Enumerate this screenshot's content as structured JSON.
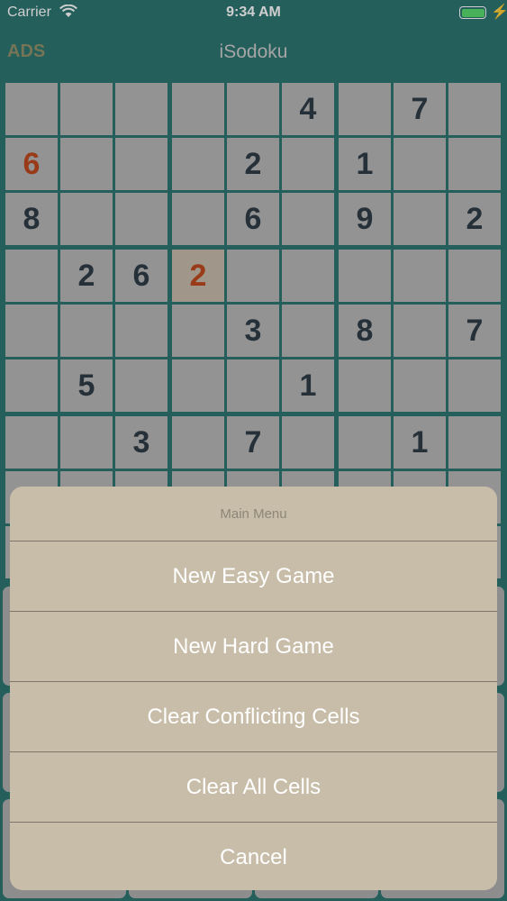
{
  "status_bar": {
    "carrier": "Carrier",
    "time": "9:34 AM"
  },
  "nav": {
    "left_button": "ADS",
    "title": "iSodoku"
  },
  "board": {
    "rows": [
      [
        "",
        "",
        "",
        "",
        "",
        "4",
        "",
        "7",
        ""
      ],
      [
        "6",
        "",
        "",
        "",
        "2",
        "",
        "1",
        "",
        ""
      ],
      [
        "8",
        "",
        "",
        "",
        "6",
        "",
        "9",
        "",
        "2"
      ],
      [
        "",
        "2",
        "6",
        "2",
        "",
        "",
        "",
        "",
        ""
      ],
      [
        "",
        "",
        "",
        "",
        "3",
        "",
        "8",
        "",
        "7"
      ],
      [
        "",
        "5",
        "",
        "",
        "",
        "1",
        "",
        "",
        ""
      ],
      [
        "",
        "",
        "3",
        "",
        "7",
        "",
        "",
        "1",
        ""
      ]
    ],
    "orange_cells": [
      [
        1,
        0
      ],
      [
        3,
        3
      ]
    ],
    "selected_cell": [
      3,
      3
    ],
    "colors": {
      "background": "#1d6b66",
      "cell": "#b0b0b0",
      "digit": "#1f2d38",
      "conflict_digit": "#b83a0d"
    }
  },
  "main_menu": {
    "title": "Main Menu",
    "actions": [
      {
        "id": "new-easy-game",
        "label": "New Easy Game"
      },
      {
        "id": "new-hard-game",
        "label": "New Hard Game"
      },
      {
        "id": "clear-conflicting-cells",
        "label": "Clear Conflicting Cells"
      },
      {
        "id": "clear-all-cells",
        "label": "Clear All Cells"
      },
      {
        "id": "cancel",
        "label": "Cancel"
      }
    ]
  }
}
